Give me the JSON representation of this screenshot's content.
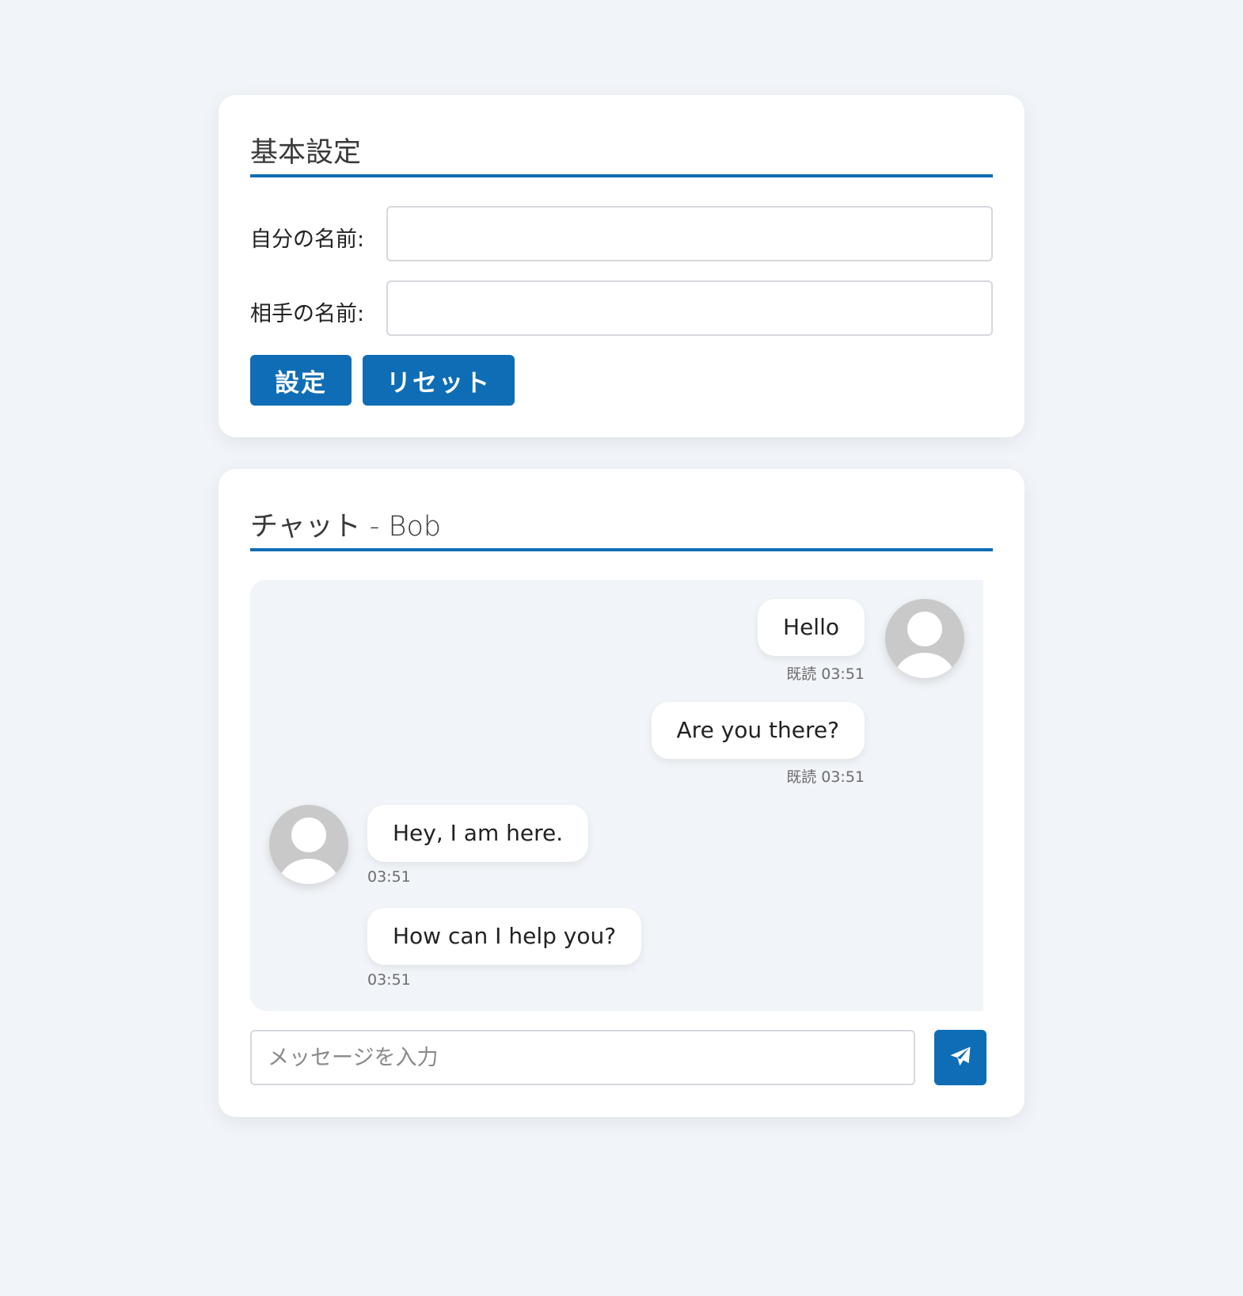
{
  "settings": {
    "title": "基本設定",
    "my_name_label": "自分の名前:",
    "my_name_value": "",
    "partner_name_label": "相手の名前:",
    "partner_name_value": "",
    "set_button_label": "設定",
    "reset_button_label": "リセット"
  },
  "chat": {
    "title": "チャット - Bob",
    "messages": [
      {
        "sender": "self",
        "text": "Hello",
        "meta": "既読 03:51"
      },
      {
        "sender": "self",
        "text": "Are you there?",
        "meta": "既読 03:51"
      },
      {
        "sender": "partner",
        "text": "Hey, I am here.",
        "meta": "03:51"
      },
      {
        "sender": "partner",
        "text": "How can I help you?",
        "meta": "03:51"
      }
    ],
    "input_placeholder": "メッセージを入力",
    "input_value": "",
    "send_icon": "paper-plane-icon"
  },
  "colors": {
    "accent": "#0f6db5",
    "background": "#f1f4f8",
    "card": "#ffffff",
    "avatar": "#c9c9c9"
  }
}
